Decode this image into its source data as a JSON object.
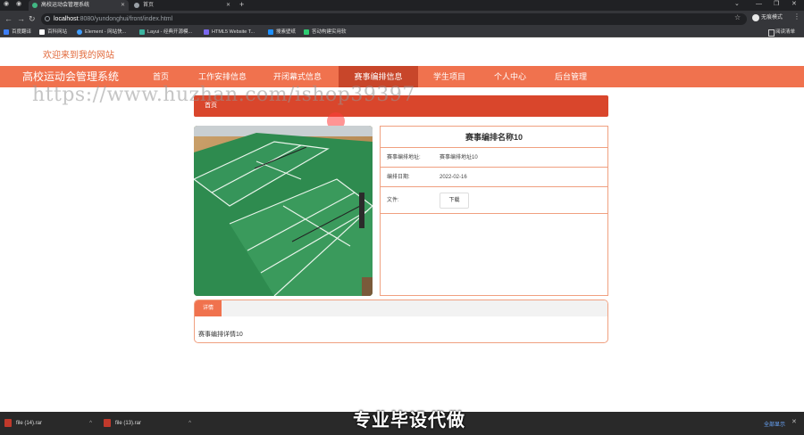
{
  "browser": {
    "tabs": [
      {
        "label": "高校运动会管理系统"
      },
      {
        "label": "首页"
      }
    ],
    "new_tab": "+",
    "controls": {
      "minimize": "—",
      "maximize": "❐",
      "close": "✕",
      "chevron": "⌄"
    },
    "url": {
      "host": "localhost",
      "path": ":8080/yundonghui/front/index.html"
    },
    "profile_label": "无痕模式",
    "bookmarks": [
      {
        "label": "百度翻译",
        "color": "#3d7ef5"
      },
      {
        "label": "百科网站",
        "color": "#ffffff"
      },
      {
        "label": "Element - 网站快...",
        "color": "#409eff"
      },
      {
        "label": "Layui - 经典开源模...",
        "color": "#3bb4a0"
      },
      {
        "label": "HTML5 Website T...",
        "color": "#7b68ee"
      },
      {
        "label": "搜素壁纸",
        "color": "#1e90ff"
      },
      {
        "label": "答动构建实用软",
        "color": "#2ecc71"
      }
    ],
    "reading_list": "阅读清单"
  },
  "site": {
    "welcome": "欢迎来到我的网站",
    "brand": "高校运动会管理系统",
    "nav": [
      {
        "label": "首页",
        "active": false
      },
      {
        "label": "工作安排信息",
        "active": false
      },
      {
        "label": "开闭幕式信息",
        "active": false
      },
      {
        "label": "赛事编排信息",
        "active": true
      },
      {
        "label": "学生项目",
        "active": false
      },
      {
        "label": "个人中心",
        "active": false
      },
      {
        "label": "后台管理",
        "active": false
      }
    ],
    "watermark": "https://www.huzhan.com/ishop39397",
    "breadcrumb_title": "首页",
    "card": {
      "title": "赛事编排名称10",
      "rows": [
        {
          "label": "赛事编排地址:",
          "value": "赛事编排地址10"
        },
        {
          "label": "编排日期:",
          "value": "2022-02-16"
        }
      ],
      "file_label": "文件:",
      "download_label": "下载"
    },
    "detail": {
      "tab_label": "详情",
      "content": "赛事编排详情10"
    },
    "accent_color": "#f0724e",
    "active_nav_color": "#c8462a"
  },
  "taskbar": {
    "downloads": [
      {
        "label": "file (14).rar"
      },
      {
        "label": "file (13).rar"
      }
    ],
    "show_all": "全部显示",
    "caption": "专业毕设代做"
  }
}
